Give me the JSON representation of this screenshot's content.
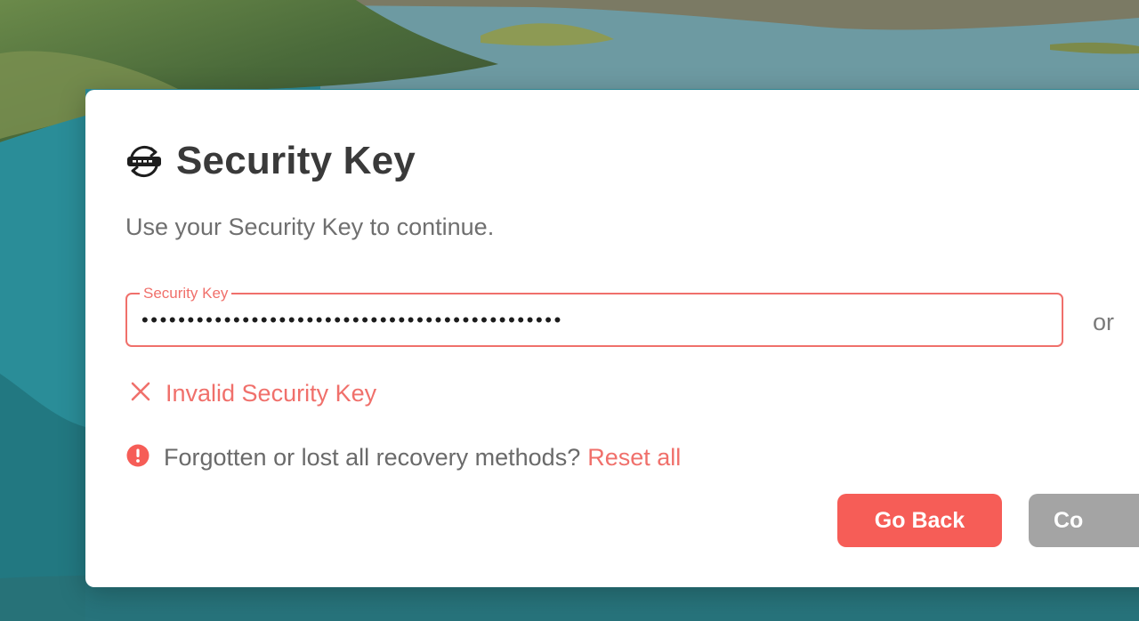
{
  "dialog": {
    "title": "Security Key",
    "title_icon": "security-key-sync-icon",
    "subtitle": "Use your Security Key to continue.",
    "field": {
      "label": "Security Key",
      "value": "••••••••••••••••••••••••••••••••••••••••••••••"
    },
    "alternative_label": "or",
    "error": {
      "icon": "close-icon",
      "text": "Invalid Security Key"
    },
    "recovery": {
      "icon": "alert-circle-icon",
      "text": "Forgotten or lost all recovery methods?",
      "link": "Reset all"
    },
    "buttons": {
      "back": "Go Back",
      "continue": "Co"
    }
  },
  "colors": {
    "accent": "#f65d57",
    "error": "#f0706b",
    "title": "#3a3a3a",
    "muted": "#6f6f6f",
    "disabled_button": "#a4a4a4"
  }
}
